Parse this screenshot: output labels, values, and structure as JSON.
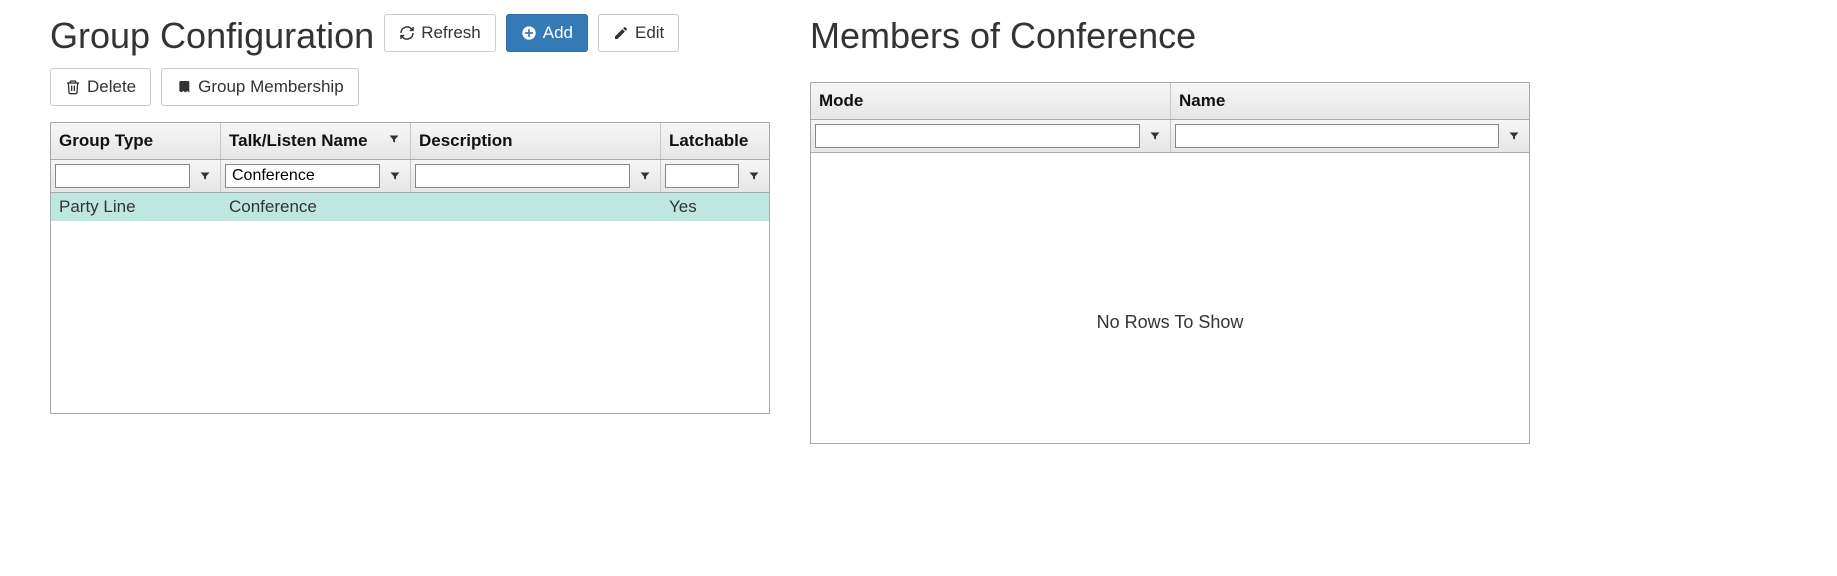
{
  "left": {
    "title": "Group Configuration",
    "buttons": {
      "refresh": "Refresh",
      "add": "Add",
      "edit": "Edit",
      "delete": "Delete",
      "group_membership": "Group Membership"
    },
    "columns": {
      "group_type": "Group Type",
      "talk_listen_name": "Talk/Listen Name",
      "description": "Description",
      "latchable": "Latchable"
    },
    "filters": {
      "group_type": "",
      "talk_listen_name": "Conference",
      "description": "",
      "latchable": ""
    },
    "rows": [
      {
        "group_type": "Party Line",
        "talk_listen_name": "Conference",
        "description": "",
        "latchable": "Yes",
        "selected": true
      }
    ]
  },
  "right": {
    "title": "Members of Conference",
    "columns": {
      "mode": "Mode",
      "name": "Name"
    },
    "filters": {
      "mode": "",
      "name": ""
    },
    "rows": [],
    "empty_text": "No Rows To Show"
  },
  "colors": {
    "primary": "#337ab7",
    "selected_row": "#bfe7e2"
  }
}
